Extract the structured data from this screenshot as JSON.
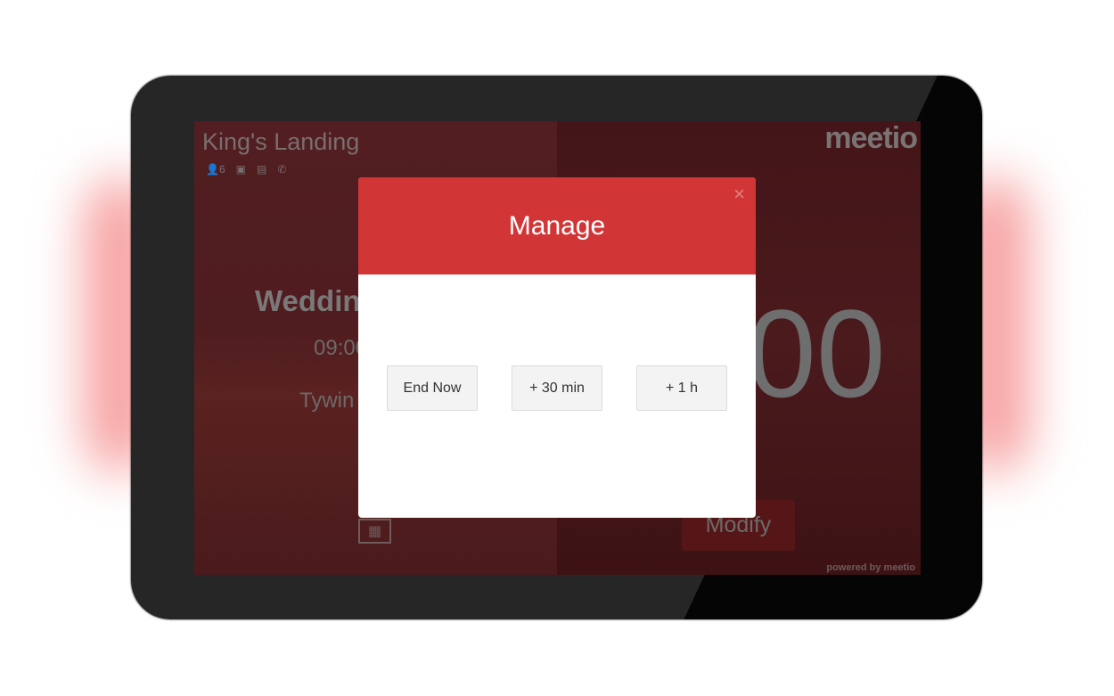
{
  "room": {
    "name": "King's Landing",
    "capacity": "6",
    "amenity_icons": [
      "person-icon",
      "display-icon",
      "projector-icon",
      "phone-icon"
    ]
  },
  "meeting": {
    "title": "Weddin",
    "time": "09:00",
    "organizer": "Tywin"
  },
  "clock_partial": "00",
  "logo": "meetio",
  "powered_by": "powered by meetio",
  "modify_label": "Modify",
  "modal": {
    "title": "Manage",
    "close": "×",
    "buttons": [
      "End Now",
      "+ 30 min",
      "+ 1 h"
    ]
  },
  "colors": {
    "accent": "#d23535",
    "overlay": "#4a1a1d"
  }
}
